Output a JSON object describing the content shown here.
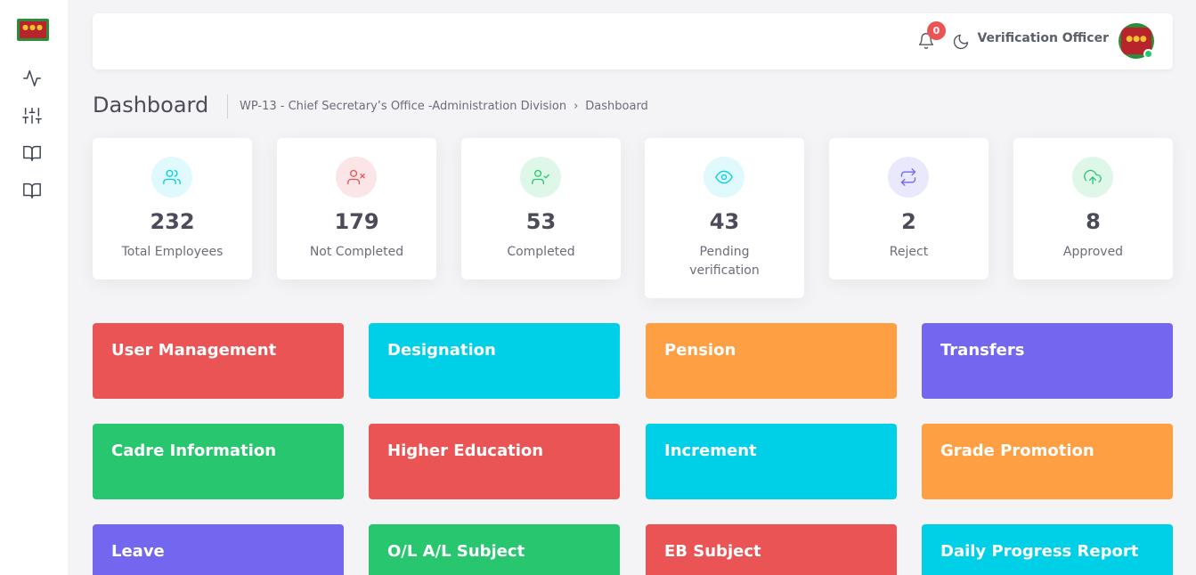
{
  "app": {
    "logo_icon": "emblem-logo-icon",
    "colors": {
      "red": "#ea5455",
      "cyan": "#00cfe8",
      "orange": "#ff9f43",
      "purple": "#7367f0",
      "green": "#28c76f"
    }
  },
  "sidebar": {
    "items": [
      {
        "icon": "activity-icon"
      },
      {
        "icon": "sliders-icon"
      },
      {
        "icon": "book-open-icon"
      },
      {
        "icon": "book-open-icon"
      }
    ]
  },
  "header": {
    "notification_icon": "bell-icon",
    "notification_count": "0",
    "theme_icon": "moon-icon",
    "user_name": "Verification Officer",
    "avatar_icon": "emblem-avatar"
  },
  "page": {
    "title": "Dashboard",
    "breadcrumb": {
      "section": "WP-13 - Chief Secretary’s Office -Administration Division",
      "separator": "›",
      "current": "Dashboard"
    }
  },
  "stats": [
    {
      "value": "232",
      "label": "Total Employees",
      "icon": "users-icon",
      "color": "#00cfe8"
    },
    {
      "value": "179",
      "label": "Not Completed",
      "icon": "user-x-icon",
      "color": "#ea5455"
    },
    {
      "value": "53",
      "label": "Completed",
      "icon": "user-check-icon",
      "color": "#28c76f"
    },
    {
      "value": "43",
      "label": "Pending verification",
      "icon": "eye-icon",
      "color": "#00cfe8"
    },
    {
      "value": "2",
      "label": "Reject",
      "icon": "repeat-icon",
      "color": "#7367f0"
    },
    {
      "value": "8",
      "label": "Approved",
      "icon": "upload-cloud-icon",
      "color": "#28c76f"
    }
  ],
  "tiles": [
    {
      "label": "User Management",
      "color": "#ea5455"
    },
    {
      "label": "Designation",
      "color": "#00cfe8"
    },
    {
      "label": "Pension",
      "color": "#ff9f43"
    },
    {
      "label": "Transfers",
      "color": "#7367f0"
    },
    {
      "label": "Cadre Information",
      "color": "#28c76f"
    },
    {
      "label": "Higher Education",
      "color": "#ea5455"
    },
    {
      "label": "Increment",
      "color": "#00cfe8"
    },
    {
      "label": "Grade Promotion",
      "color": "#ff9f43"
    },
    {
      "label": "Leave",
      "color": "#7367f0"
    },
    {
      "label": "O/L A/L Subject",
      "color": "#28c76f"
    },
    {
      "label": "EB Subject",
      "color": "#ea5455"
    },
    {
      "label": "Daily Progress Report",
      "color": "#00cfe8"
    }
  ]
}
